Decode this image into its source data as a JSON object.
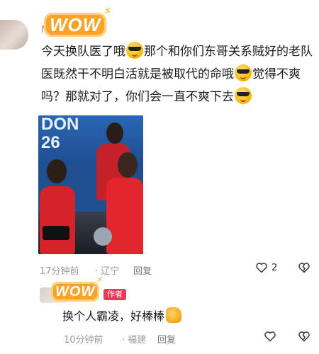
{
  "comment1": {
    "username": "N…f",
    "text": {
      "part1": "今天换队医了哦",
      "part2": "那个和你们东哥关系贼好的老队医既然干不明白活就是被取代的命哦",
      "part3": "觉得不爽吗？那就对了，你们会一直不爽下去"
    },
    "photo_banner_text": "DON\n26",
    "time": "17分钟前",
    "location": "· 辽宁",
    "reply_label": "回复",
    "like_count": "2"
  },
  "comment2": {
    "author_badge": "作者",
    "text": "换个人霸凌，好棒棒",
    "time": "10分钟前",
    "location": "· 福建",
    "reply_label": "回复"
  },
  "stickers": {
    "wow1": "WOW",
    "wow2": "WOW"
  },
  "colors": {
    "wow_orange": "#f7a428",
    "badge_red": "#e93a55",
    "meta_gray": "#9a9a9a"
  }
}
